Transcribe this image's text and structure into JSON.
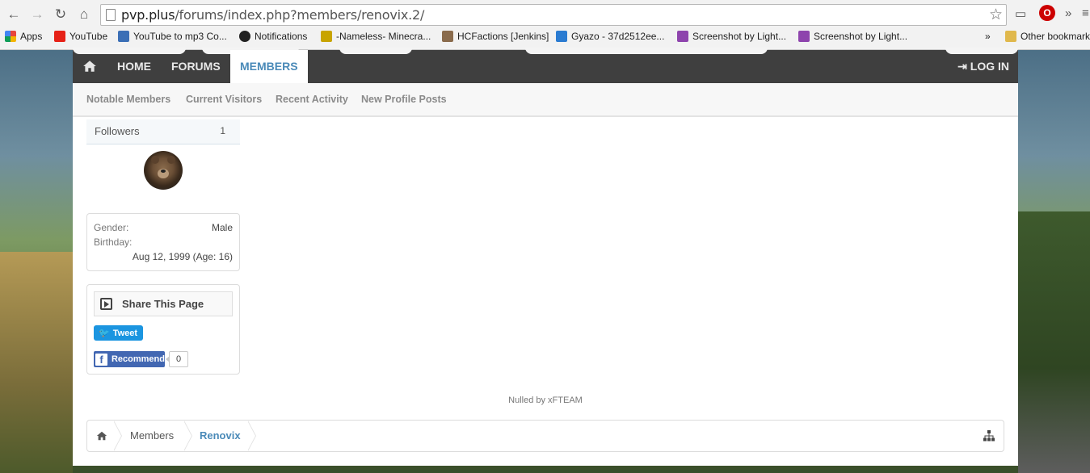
{
  "browser": {
    "url_host": "pvp.plus",
    "url_path": "/forums/index.php?members/renovix.2/",
    "bookmarks": [
      {
        "label": "Apps",
        "color": "#e8453c"
      },
      {
        "label": "YouTube",
        "color": "#e62117"
      },
      {
        "label": "YouTube to mp3 Co...",
        "color": "#3b6fb6"
      },
      {
        "label": "Notifications",
        "color": "#222222"
      },
      {
        "label": "-Nameless- Minecra...",
        "color": "#c8a400"
      },
      {
        "label": "HCFactions [Jenkins]",
        "color": "#8a6b4c"
      },
      {
        "label": "Gyazo - 37d2512ee...",
        "color": "#2a7bd1"
      },
      {
        "label": "Screenshot by Light...",
        "color": "#8e44ad"
      },
      {
        "label": "Screenshot by Light...",
        "color": "#8e44ad"
      }
    ],
    "bookmarks_overflow": "»",
    "other_bookmarks": "Other bookmarks"
  },
  "nav": {
    "tabs": [
      "HOME",
      "FORUMS",
      "MEMBERS"
    ],
    "active_tab": "MEMBERS",
    "login": "LOG IN"
  },
  "subnav": {
    "links": [
      "Notable Members",
      "Current Visitors",
      "Recent Activity",
      "New Profile Posts"
    ]
  },
  "profile": {
    "followers_label": "Followers",
    "followers_count": "1",
    "gender_label": "Gender:",
    "gender_value": "Male",
    "birthday_label": "Birthday:",
    "birthday_value": "Aug 12, 1999 (Age: 16)"
  },
  "share": {
    "title": "Share This Page",
    "tweet": "Tweet",
    "recommend": "Recommend",
    "recommend_count": "0"
  },
  "footer_note": "Nulled by xFTEAM",
  "breadcrumb": {
    "items": [
      "Members",
      "Renovix"
    ]
  },
  "colors": {
    "accent": "#4a8ab8",
    "navbar": "#3f3f3f",
    "twitter": "#1b95e0",
    "facebook": "#4267b2"
  }
}
